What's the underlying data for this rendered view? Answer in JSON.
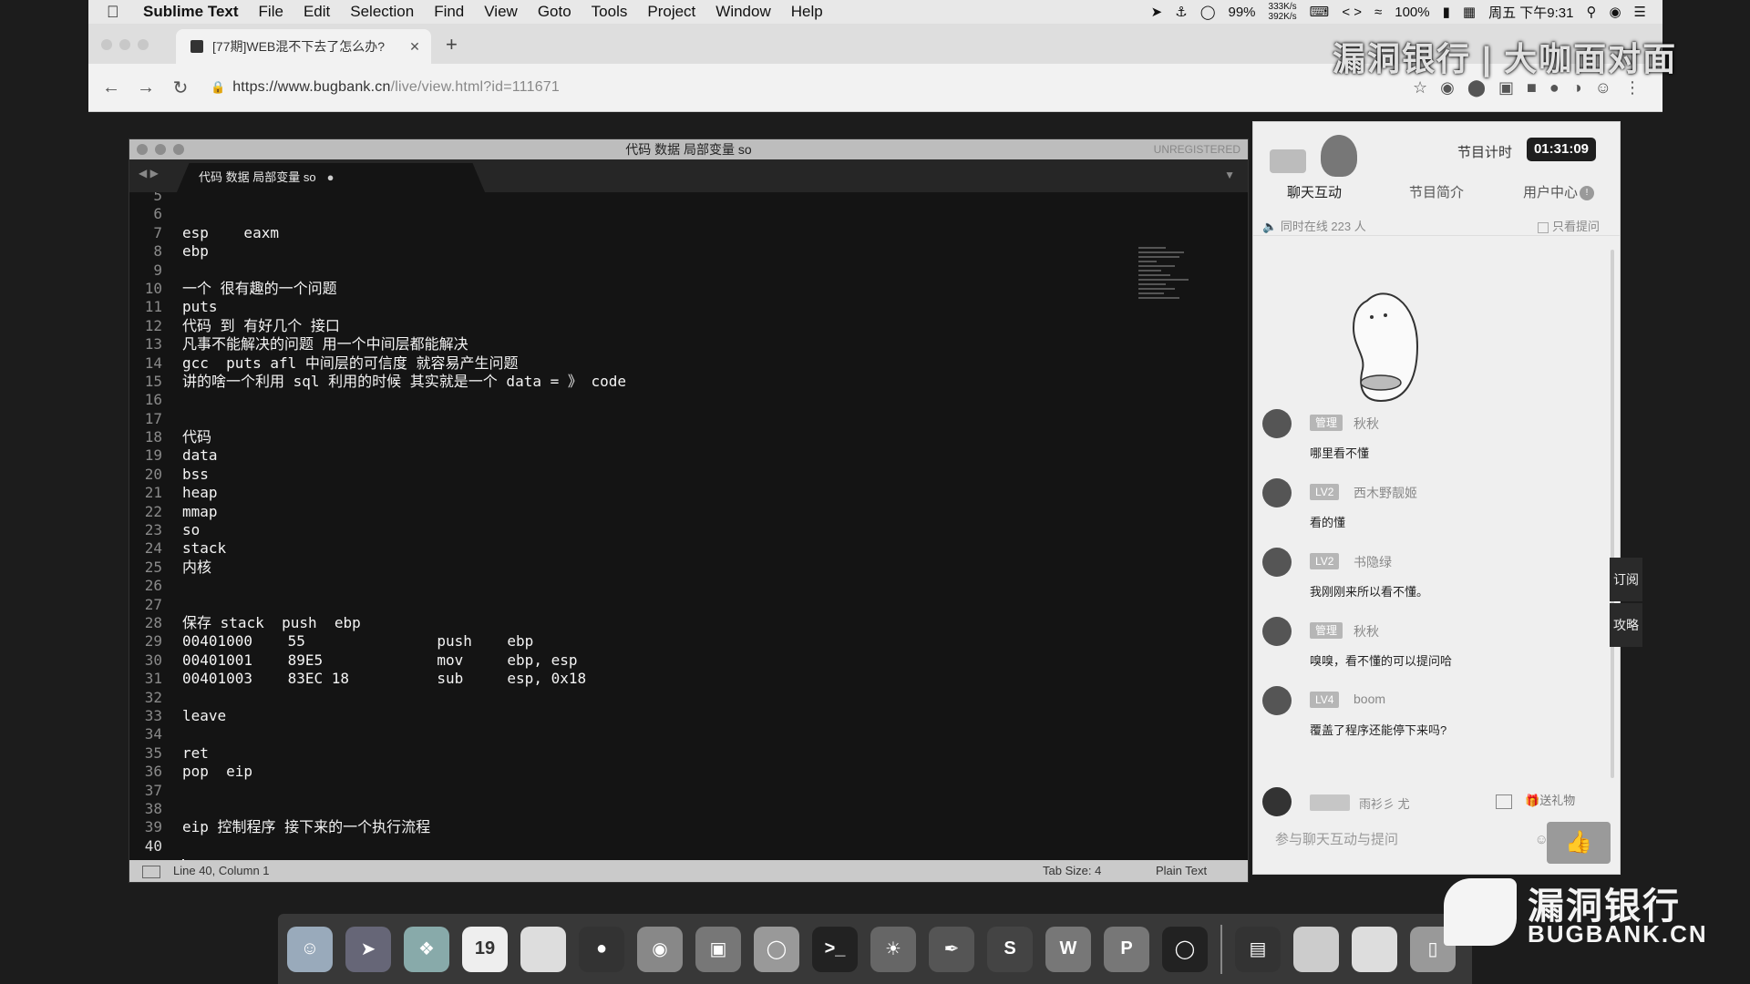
{
  "menubar": {
    "app_name": "Sublime Text",
    "menus": [
      "File",
      "Edit",
      "Selection",
      "Find",
      "View",
      "Goto",
      "Tools",
      "Project",
      "Window",
      "Help"
    ],
    "battery_pct_a": "99%",
    "net_up": "333K/s",
    "net_down": "392K/s",
    "battery_pct_b": "100%",
    "clock": "周五 下午9:31"
  },
  "browser": {
    "tab_title": "[77期]WEB混不下去了怎么办?",
    "url_host": "https://www.bugbank.cn",
    "url_path": "/live/view.html?id=111671"
  },
  "watermark_top": "漏洞银行 | 大咖面对面",
  "sublime": {
    "window_title": "代码 数据 局部变量 so",
    "unregistered": "UNREGISTERED",
    "tab_label": "代码 数据 局部变量 so",
    "lines": [
      {
        "n": "5",
        "t": ""
      },
      {
        "n": "6",
        "t": ""
      },
      {
        "n": "7",
        "t": "esp    eaxm"
      },
      {
        "n": "8",
        "t": "ebp"
      },
      {
        "n": "9",
        "t": ""
      },
      {
        "n": "10",
        "t": "一个 很有趣的一个问题"
      },
      {
        "n": "11",
        "t": "puts"
      },
      {
        "n": "12",
        "t": "代码 到 有好几个 接口"
      },
      {
        "n": "13",
        "t": "凡事不能解决的问题 用一个中间层都能解决"
      },
      {
        "n": "14",
        "t": "gcc  puts afl 中间层的可信度 就容易产生问题"
      },
      {
        "n": "15",
        "t": "讲的啥一个利用 sql 利用的时候 其实就是一个 data = 》 code"
      },
      {
        "n": "16",
        "t": ""
      },
      {
        "n": "17",
        "t": ""
      },
      {
        "n": "18",
        "t": "代码"
      },
      {
        "n": "19",
        "t": "data"
      },
      {
        "n": "20",
        "t": "bss"
      },
      {
        "n": "21",
        "t": "heap"
      },
      {
        "n": "22",
        "t": "mmap"
      },
      {
        "n": "23",
        "t": "so"
      },
      {
        "n": "24",
        "t": "stack"
      },
      {
        "n": "25",
        "t": "内核"
      },
      {
        "n": "26",
        "t": ""
      },
      {
        "n": "27",
        "t": ""
      },
      {
        "n": "28",
        "t": "保存 stack  push  ebp"
      },
      {
        "n": "29",
        "t": "00401000    55               push    ebp"
      },
      {
        "n": "30",
        "t": "00401001    89E5             mov     ebp, esp"
      },
      {
        "n": "31",
        "t": "00401003    83EC 18          sub     esp, 0x18"
      },
      {
        "n": "32",
        "t": ""
      },
      {
        "n": "33",
        "t": "leave"
      },
      {
        "n": "34",
        "t": ""
      },
      {
        "n": "35",
        "t": "ret"
      },
      {
        "n": "36",
        "t": "pop  eip"
      },
      {
        "n": "37",
        "t": ""
      },
      {
        "n": "38",
        "t": ""
      },
      {
        "n": "39",
        "t": "eip 控制程序 接下来的一个执行流程"
      },
      {
        "n": "40",
        "t": ""
      }
    ],
    "status_position": "Line 40, Column 1",
    "status_tab_size": "Tab Size: 4",
    "status_syntax": "Plain Text"
  },
  "chat": {
    "timer_label": "节目计时",
    "timer_value": "01:31:09",
    "tabs": [
      "聊天互动",
      "节目简介",
      "用户中心"
    ],
    "user_center_badge": "!",
    "online_text": "同时在线  223  人",
    "ask_only_label": "只看提问",
    "messages": [
      {
        "level": "管理",
        "name": "秋秋",
        "text": "哪里看不懂"
      },
      {
        "level": "LV2",
        "name": "西木野靓姬",
        "text": "看的懂"
      },
      {
        "level": "LV2",
        "name": "书隐绿",
        "text": "我刚刚来所以看不懂。"
      },
      {
        "level": "管理",
        "name": "秋秋",
        "text": "嗅嗅，看不懂的可以提问哈"
      },
      {
        "level": "LV4",
        "name": "boom",
        "text": "覆盖了程序还能停下来吗?"
      }
    ],
    "bottom_user_name": "雨衫彡 尤",
    "gift_label": "送礼物",
    "input_placeholder": "参与聊天互动与提问",
    "side_subscribe": "订阅",
    "side_guide": "攻略"
  },
  "dock": {
    "calendar_day": "19"
  },
  "watermark_bottom": {
    "cn": "漏洞银行",
    "en": "BUGBANK.CN"
  }
}
